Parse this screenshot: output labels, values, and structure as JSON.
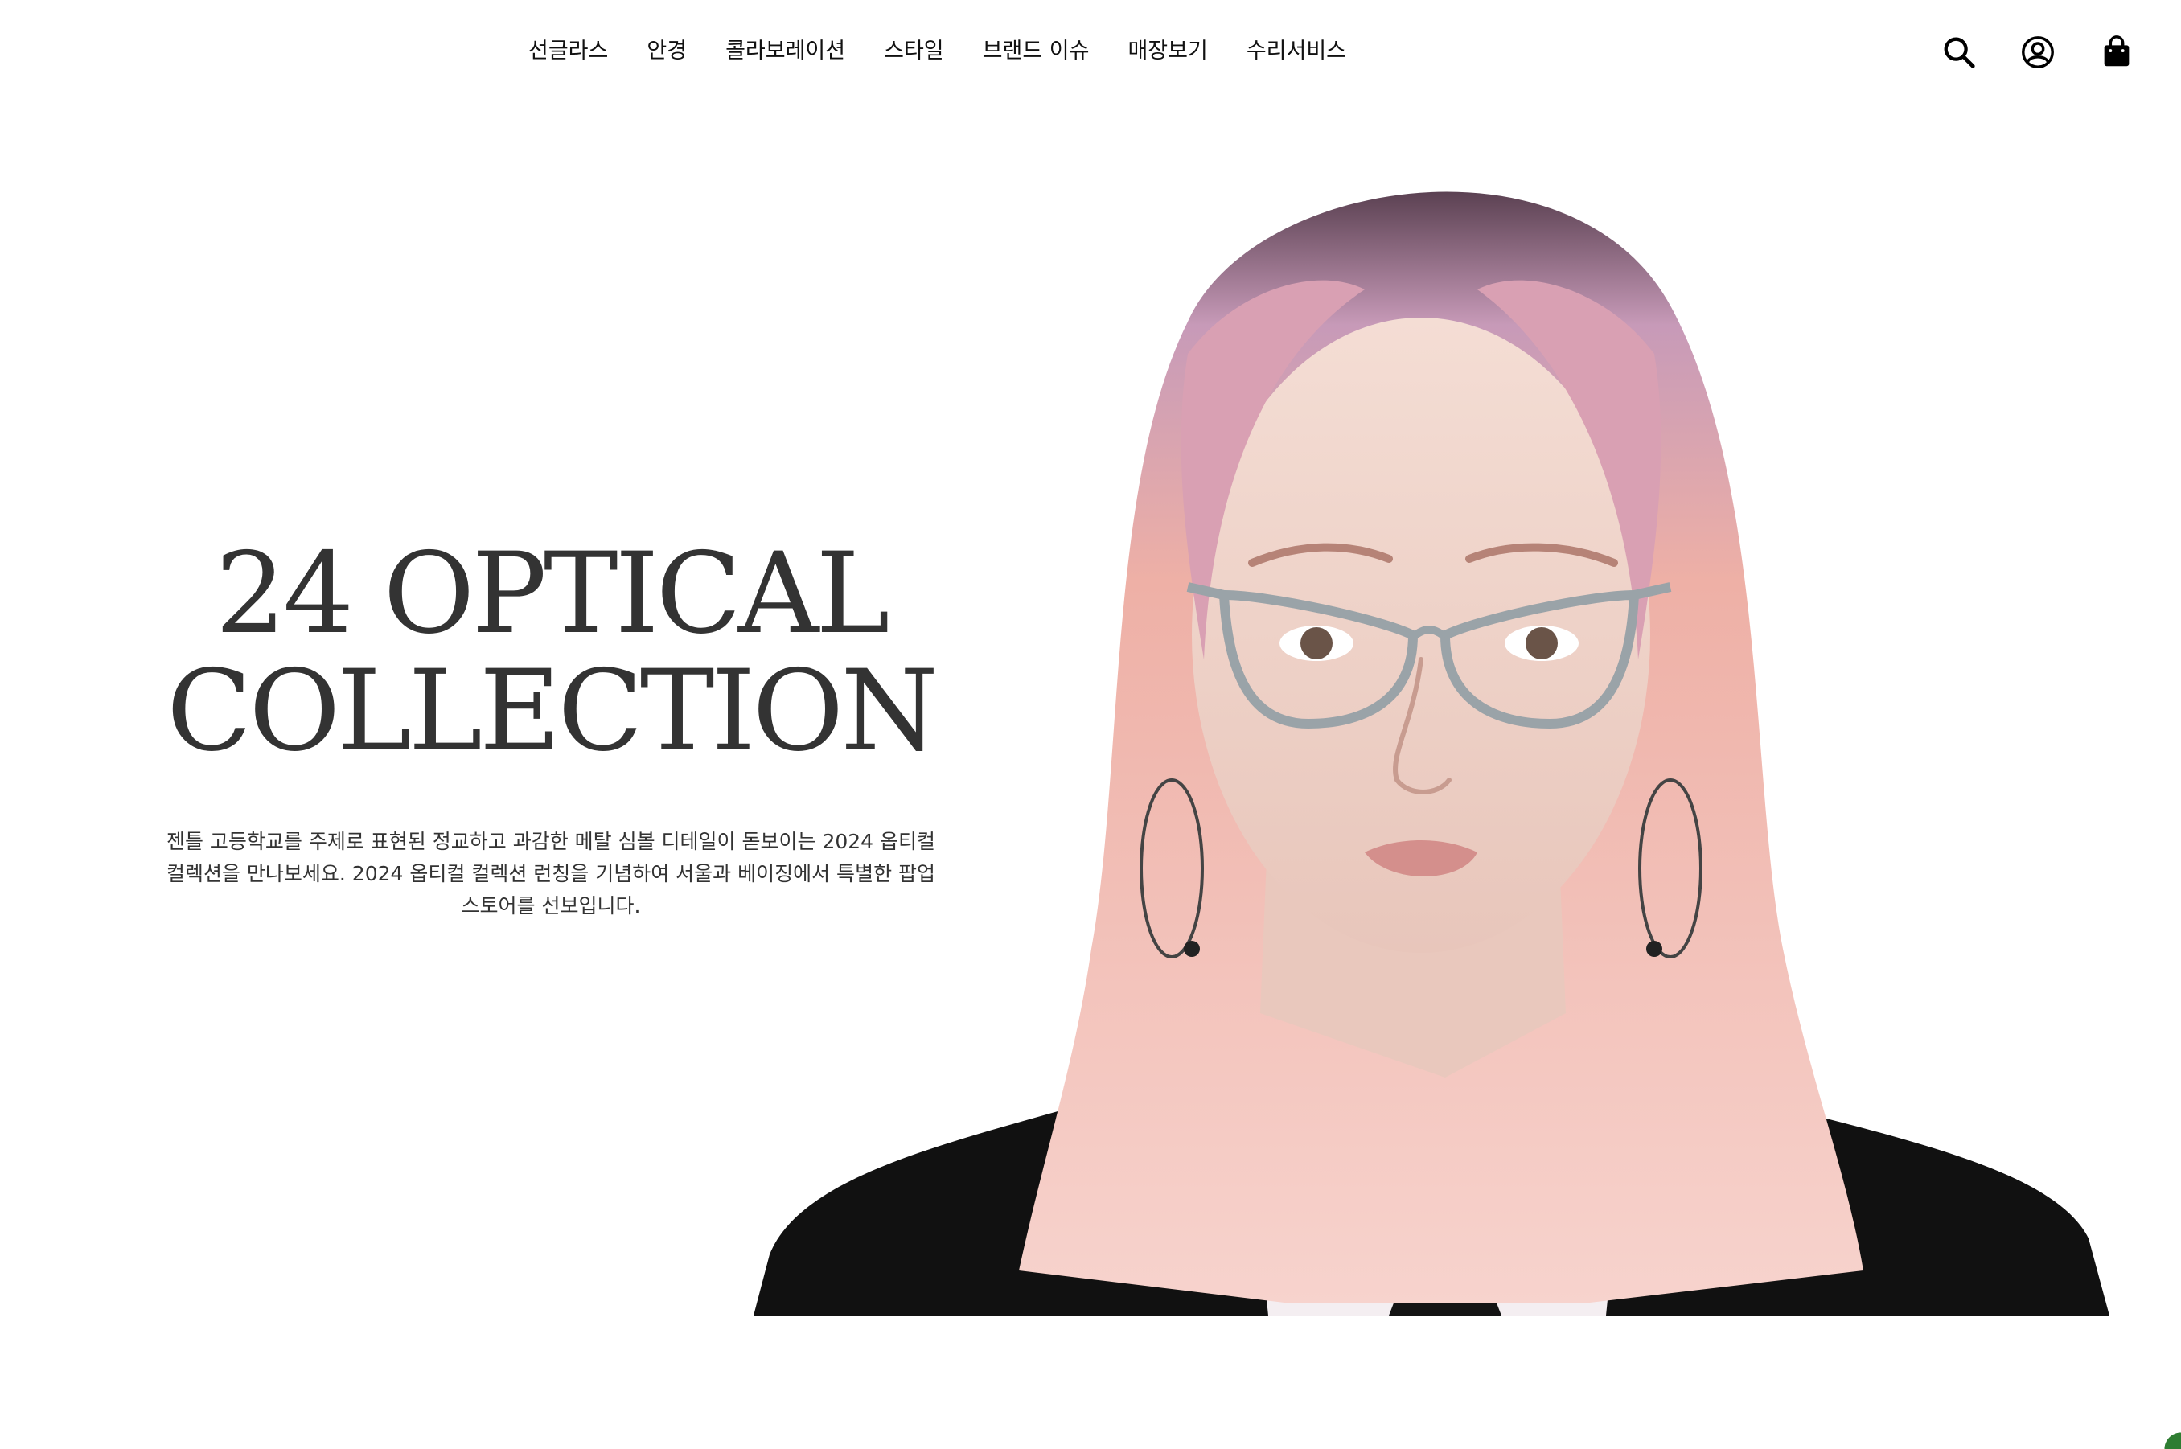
{
  "nav": {
    "items": [
      {
        "label": "선글라스"
      },
      {
        "label": "안경"
      },
      {
        "label": "콜라보레이션"
      },
      {
        "label": "스타일"
      },
      {
        "label": "브랜드 이슈"
      },
      {
        "label": "매장보기"
      },
      {
        "label": "수리서비스"
      }
    ],
    "icons": [
      "search-icon",
      "account-icon",
      "shopping-bag-icon"
    ]
  },
  "hero": {
    "title_line1": "24 OPTICAL",
    "title_line2": "COLLECTION",
    "description": "젠틀 고등학교를 주제로 표현된 정교하고 과감한 메탈 심볼 디테일이 돋보이는 2024 옵티컬 컬렉션을 만나보세요. 2024 옵티컬 컬렉션 런칭을 기념하여 서울과 베이징에서 특별한 팝업 스토어를 선보입니다."
  },
  "colors": {
    "text": "#333333",
    "background": "#ffffff",
    "hair": "#f1c3c0",
    "suit": "#111111"
  }
}
